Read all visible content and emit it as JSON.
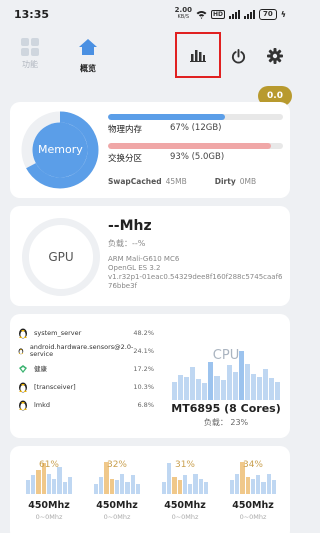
{
  "status_bar": {
    "time": "13:35",
    "net_speed": "2.00",
    "net_unit": "KB/S",
    "hd_label": "HD",
    "battery": "70"
  },
  "nav": {
    "tabs": [
      {
        "label": "功能",
        "icon": "grid-icon",
        "active": false
      },
      {
        "label": "概览",
        "icon": "home-icon",
        "active": true
      }
    ],
    "actions": [
      "bar-chart-icon",
      "power-icon",
      "gear-icon"
    ]
  },
  "badge": "0.0",
  "memory": {
    "ring_label": "Memory",
    "ram_label": "物理内存",
    "ram_value": "67% (12GB)",
    "ram_fraction": 0.67,
    "swap_label": "交换分区",
    "swap_value": "93% (5.0GB)",
    "swap_fraction": 0.93,
    "swapcached_label": "SwapCached",
    "swapcached_value": "45MB",
    "dirty_label": "Dirty",
    "dirty_value": "0MB",
    "colors": {
      "ram": "#5b9ee8",
      "swap": "#f0a7a7"
    }
  },
  "gpu": {
    "ring_label": "GPU",
    "freq": "--Mhz",
    "load": "负载：--%",
    "renderer": "ARM Mali-G610 MC6",
    "api": "OpenGL ES 3.2",
    "driver": "v1.r32p1-01eac0.54329dee8f160f288c5745caaf676bbe3f"
  },
  "cpu": {
    "watermark": "CPU",
    "name": "MT6895 (8 Cores)",
    "load": "负载：  23%",
    "processes": [
      {
        "name": "system_server",
        "pct": "48.2%",
        "icon": "linux-icon"
      },
      {
        "name": "android.hardware.sensors@2.0-service",
        "pct": "24.1%",
        "icon": "linux-icon"
      },
      {
        "name": "健康",
        "pct": "17.2%",
        "icon": "app-icon"
      },
      {
        "name": "[transceiver]",
        "pct": "10.3%",
        "icon": "linux-icon"
      },
      {
        "name": "lmkd",
        "pct": "6.8%",
        "icon": "linux-icon"
      }
    ]
  },
  "cores": [
    {
      "pct": "61%",
      "freq": "450Mhz",
      "range": "0~0Mhz"
    },
    {
      "pct": "32%",
      "freq": "450Mhz",
      "range": "0~0Mhz"
    },
    {
      "pct": "31%",
      "freq": "450Mhz",
      "range": "0~0Mhz"
    },
    {
      "pct": "34%",
      "freq": "450Mhz",
      "range": "0~0Mhz"
    }
  ]
}
